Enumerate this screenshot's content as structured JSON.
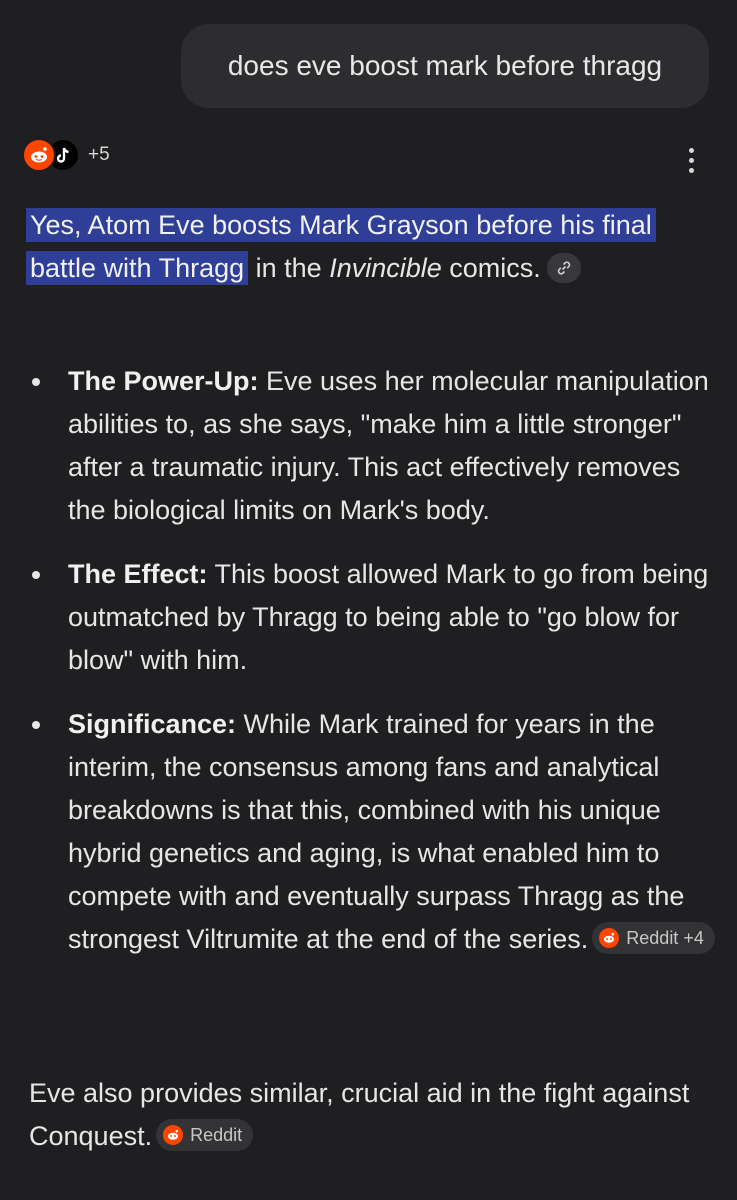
{
  "user_query": "does eve boost mark before thragg",
  "sources": {
    "icons": [
      "reddit-icon",
      "tiktok-icon"
    ],
    "more_count": "+5"
  },
  "answer": {
    "highlight": "Yes, Atom Eve boosts Mark Grayson before his final battle with Thragg",
    "text_mid": " in the ",
    "italic": "Invincible",
    "text_end": " comics."
  },
  "bullets": [
    {
      "title": "The Power-Up:",
      "text": " Eve uses her molecular manipulation abilities to, as she says, \"make him a little stronger\" after a traumatic injury. This act effectively removes the biological limits on Mark's body."
    },
    {
      "title": "The Effect:",
      "text": " This boost allowed Mark to go from being outmatched by Thragg to being able to \"go blow for blow\" with him."
    },
    {
      "title": "Significance:",
      "text": " While Mark trained for years in the interim, the consensus among fans and analytical breakdowns is that this, combined with his unique hybrid genetics and aging, is what enabled him to compete with and eventually surpass Thragg as the strongest Viltrumite at the end of the series.",
      "chip": "Reddit +4"
    }
  ],
  "closing": {
    "text": "Eve also provides similar, crucial aid in the fight against Conquest.",
    "chip": "Reddit"
  },
  "colors": {
    "background": "#1f1f21",
    "highlight": "#2f3f98",
    "reddit": "#ff4500"
  }
}
